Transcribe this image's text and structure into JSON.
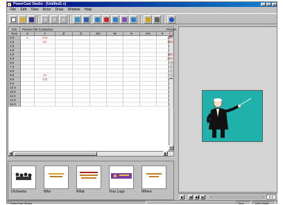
{
  "window": {
    "title": "PowerCast Studio - [Untitled1 x]"
  },
  "menu": [
    "File",
    "Edit",
    "View",
    "Actor",
    "Draw",
    "Window",
    "Help"
  ],
  "score": {
    "grab_label": "Grb",
    "title": "Picture File Conductor",
    "right_title": "Picture F",
    "columns": [
      "Time",
      "X",
      "Y",
      "E",
      "D",
      "Z%",
      "W",
      "H",
      "V%",
      "X"
    ],
    "rows": [
      {
        "time": "0.0",
        "x": "5",
        "y": "103",
        "right": "240"
      },
      {
        "time": "1.0",
        "x": "",
        "y": "92",
        "right": "128"
      },
      {
        "time": "2.0",
        "x": "",
        "y": "",
        "right": ""
      },
      {
        "time": "3.0",
        "x": "",
        "y": "",
        "right": ""
      },
      {
        "time": "4.0",
        "x": "",
        "y": "",
        "right": "128"
      },
      {
        "time": "5.0",
        "x": "",
        "y": "",
        "right": "240"
      },
      {
        "time": "6.0",
        "x": "",
        "y": "",
        "right": ""
      },
      {
        "time": "7.0",
        "x": "",
        "y": "",
        "right": ""
      },
      {
        "time": "8.0",
        "x": "",
        "y": "",
        "right": ""
      },
      {
        "time": "9.0",
        "x": "",
        "y": "15",
        "right": ""
      },
      {
        "time": "9.0",
        "x": "",
        "y": "103",
        "right": ""
      },
      {
        "time": "9.0",
        "x": "",
        "y": "",
        "right": ""
      },
      {
        "time": "10.0",
        "x": "",
        "y": "",
        "right": ""
      },
      {
        "time": "10.0",
        "x": "",
        "y": "",
        "right": ""
      },
      {
        "time": "11.0",
        "x": "",
        "y": "",
        "right": ""
      },
      {
        "time": "12.0",
        "x": "",
        "y": "",
        "right": ""
      },
      {
        "time": "13.0",
        "x": "",
        "y": "",
        "right": ""
      }
    ]
  },
  "bin": {
    "clips": [
      {
        "label": "Orchestra"
      },
      {
        "label": "Who"
      },
      {
        "label": "What"
      },
      {
        "label": "Your Logo"
      },
      {
        "label": "Where"
      }
    ]
  },
  "player": {
    "readout": "0.0"
  },
  "status": {
    "left": "PowerCast Studio",
    "mid": "Time",
    "right": "100% NUM"
  },
  "colors": {
    "stage_bg": "#20b2aa",
    "title_bar": "#00007b"
  }
}
